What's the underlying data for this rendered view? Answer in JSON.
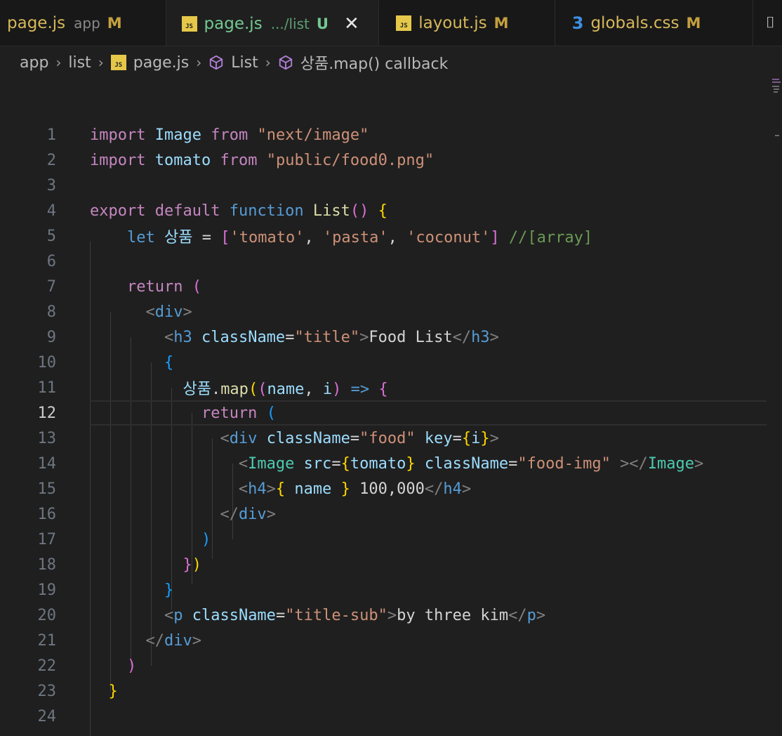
{
  "tabs": [
    {
      "name": "page.js",
      "desc": "app",
      "status": "M"
    },
    {
      "name": "page.js",
      "desc": ".../list",
      "status": "U",
      "close": "✕"
    },
    {
      "name": "layout.js",
      "desc": "",
      "status": "M"
    },
    {
      "name": "globals.css",
      "desc": "",
      "status": "M"
    }
  ],
  "breadcrumb": {
    "app": "app",
    "list": "list",
    "file": "page.js",
    "component": "List",
    "callback": "상품.map() callback"
  },
  "gutter": [
    "1",
    "2",
    "3",
    "4",
    "5",
    "6",
    "7",
    "8",
    "9",
    "10",
    "11",
    "12",
    "13",
    "14",
    "15",
    "16",
    "17",
    "18",
    "19",
    "20",
    "21",
    "22",
    "23",
    "24"
  ],
  "code": {
    "l1": {
      "a": "import",
      "b": "Image",
      "c": "from",
      "d": "\"next/image\""
    },
    "l2": {
      "a": "import",
      "b": "tomato",
      "c": "from",
      "d": "\"public/food0.png\""
    },
    "l4": {
      "a": "export",
      "b": "default",
      "c": "function",
      "d": "List",
      "e": "()",
      "f": "{"
    },
    "l5": {
      "a": "let",
      "b": "상품",
      "c": "=",
      "d": "[",
      "e": "'tomato'",
      "f": ",",
      "g": "'pasta'",
      "h": ",",
      "i": "'coconut'",
      "j": "]",
      "k": "//[array]"
    },
    "l7": {
      "a": "return",
      "b": "("
    },
    "l8": {
      "a": "<",
      "b": "div",
      "c": ">"
    },
    "l9": {
      "a": "<",
      "b": "h3",
      "c": "className",
      "d": "=",
      "e": "\"title\"",
      "f": ">",
      "g": "Food List",
      "h": "</",
      "i": "h3",
      "j": ">"
    },
    "l10": {
      "a": "{"
    },
    "l11": {
      "a": "상품",
      "b": ".",
      "c": "map",
      "d": "(",
      "e": "(",
      "f": "name",
      ".g": ",",
      "h": "i",
      "i": ")",
      "j": "=>",
      "k": "{"
    },
    "l12": {
      "a": "return",
      "b": "("
    },
    "l13": {
      "a": "<",
      "b": "div",
      "c": "className",
      "d": "=",
      "e": "\"food\"",
      "f": "key",
      "g": "=",
      "h": "{",
      "i": "i",
      "j": "}",
      "k": ">"
    },
    "l14": {
      "a": "<",
      "b": "Image",
      "c": "src",
      "d": "=",
      "e": "{",
      "f": "tomato",
      "g": "}",
      "h": "className",
      "i": "=",
      "j": "\"food-img\"",
      "k": "></",
      "l": "Image",
      "m": ">"
    },
    "l15": {
      "a": "<",
      "b": "h4",
      "c": ">",
      "d": "{",
      "e": "name",
      "f": "}",
      "g": "100,000",
      "h": "</",
      "i": "h4",
      "j": ">"
    },
    "l16": {
      "a": "</",
      "b": "div",
      "c": ">"
    },
    "l17": {
      "a": ")"
    },
    "l18": {
      "a": "}",
      "b": ")"
    },
    "l19": {
      "a": "}"
    },
    "l20": {
      "a": "<",
      "b": "p",
      "c": "className",
      "d": "=",
      "e": "\"title-sub\"",
      "f": ">",
      "g": "by three kim",
      "h": "</",
      "i": "p",
      "j": ">"
    },
    "l21": {
      "a": "</",
      "b": "div",
      "c": ">"
    },
    "l22": {
      "a": ")"
    },
    "l23": {
      "a": "}"
    }
  },
  "colors": {
    "background": "#1f1f1f",
    "keyword": "#c586c0",
    "string": "#ce9178",
    "git_untracked": "#73c991"
  }
}
